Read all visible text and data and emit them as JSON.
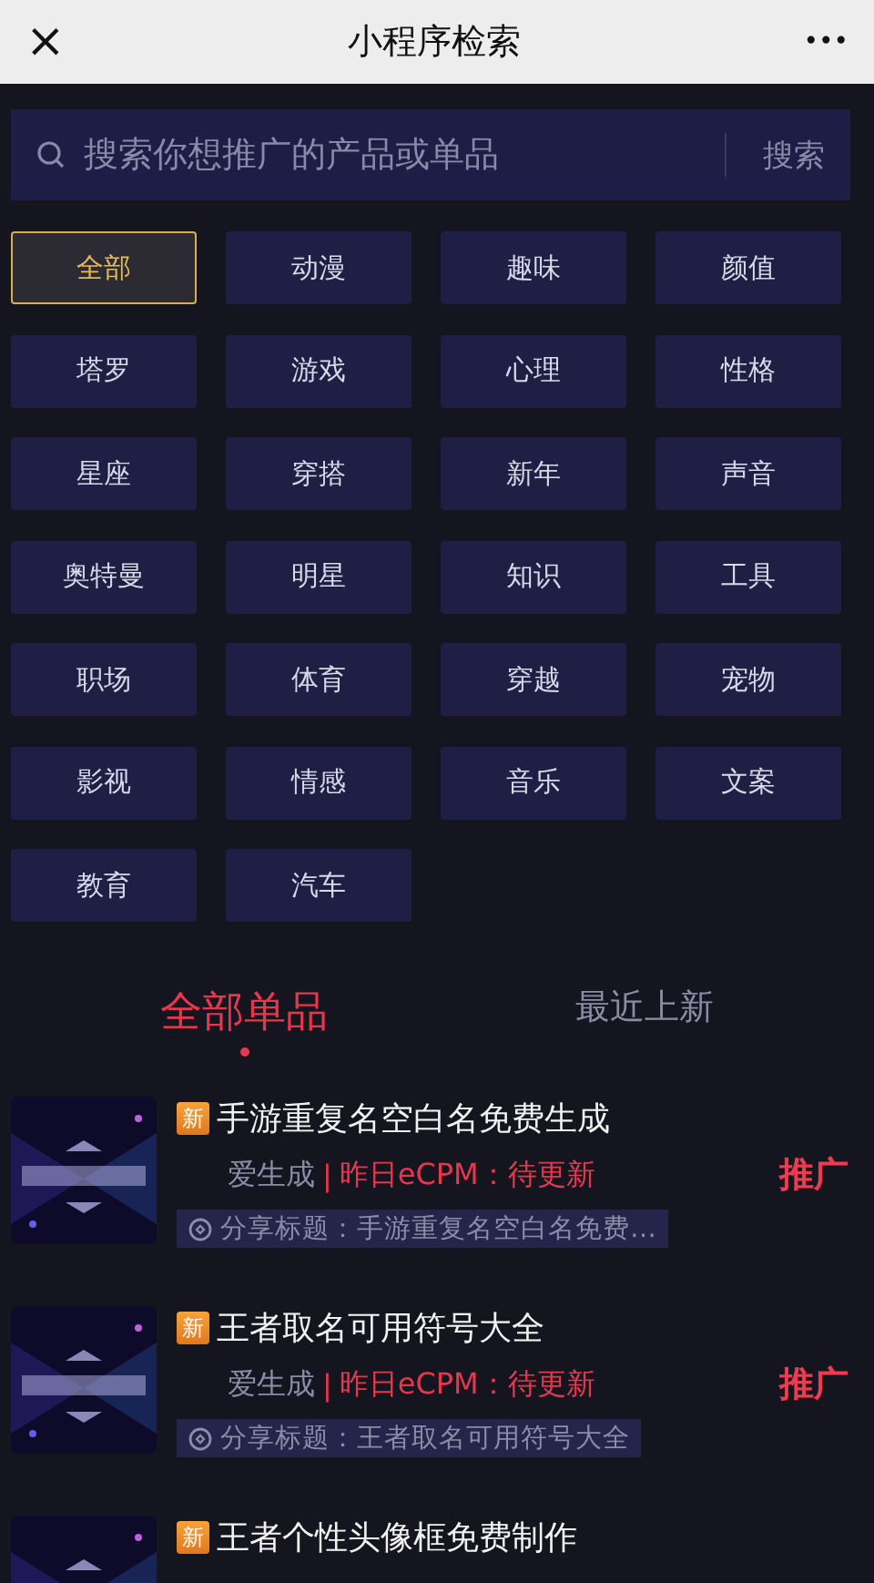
{
  "nav": {
    "close": "×",
    "title": "小程序检索",
    "more": "•••"
  },
  "search": {
    "placeholder": "搜索你想推广的产品或单品",
    "button": "搜索"
  },
  "categories": [
    {
      "label": "全部",
      "selected": true
    },
    {
      "label": "动漫",
      "selected": false
    },
    {
      "label": "趣味",
      "selected": false
    },
    {
      "label": "颜值",
      "selected": false
    },
    {
      "label": "塔罗",
      "selected": false
    },
    {
      "label": "游戏",
      "selected": false
    },
    {
      "label": "心理",
      "selected": false
    },
    {
      "label": "性格",
      "selected": false
    },
    {
      "label": "星座",
      "selected": false
    },
    {
      "label": "穿搭",
      "selected": false
    },
    {
      "label": "新年",
      "selected": false
    },
    {
      "label": "声音",
      "selected": false
    },
    {
      "label": "奥特曼",
      "selected": false
    },
    {
      "label": "明星",
      "selected": false
    },
    {
      "label": "知识",
      "selected": false
    },
    {
      "label": "工具",
      "selected": false
    },
    {
      "label": "职场",
      "selected": false
    },
    {
      "label": "体育",
      "selected": false
    },
    {
      "label": "穿越",
      "selected": false
    },
    {
      "label": "宠物",
      "selected": false
    },
    {
      "label": "影视",
      "selected": false
    },
    {
      "label": "情感",
      "selected": false
    },
    {
      "label": "音乐",
      "selected": false
    },
    {
      "label": "文案",
      "selected": false
    },
    {
      "label": "教育",
      "selected": false
    },
    {
      "label": "汽车",
      "selected": false
    }
  ],
  "tabs": [
    {
      "label": "全部单品",
      "selected": true
    },
    {
      "label": "最近上新",
      "selected": false
    }
  ],
  "items": [
    {
      "badge": "新",
      "title": "手游重复名空白名免费生成",
      "source": "爱生成",
      "separator": "|",
      "ecpm": "昨日eCPM：待更新",
      "action": "推广",
      "share": "分享标题：手游重复名空白名免费…"
    },
    {
      "badge": "新",
      "title": "王者取名可用符号大全",
      "source": "爱生成",
      "separator": "|",
      "ecpm": "昨日eCPM：待更新",
      "action": "推广",
      "share": "分享标题：王者取名可用符号大全"
    },
    {
      "badge": "新",
      "title": "王者个性头像框免费制作"
    }
  ]
}
